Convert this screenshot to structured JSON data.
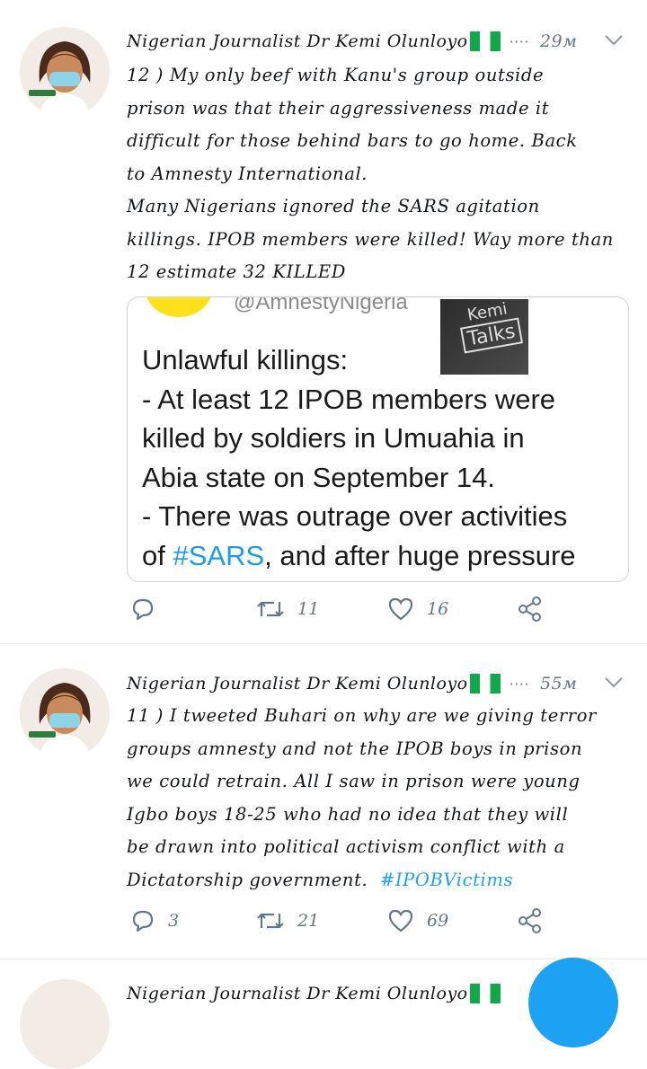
{
  "tweets": [
    {
      "author": "Nigerian Journalist Dr Kemi Olunloyo",
      "time": "29м",
      "text_lines": [
        "12 ) My only beef with Kanu's group outside",
        "prison was that their aggressiveness made it",
        "difficult for those behind bars to go home. Back",
        "to Amnesty International.",
        "Many Nigerians ignored the SARS agitation",
        "killings. IPOB members were killed! Way more than",
        "12 estimate 32 KILLED"
      ],
      "card": {
        "handle": "@AmnestyNigeria",
        "badge_line1": "Kemi",
        "badge_line2": "Talks",
        "lines": [
          "Unlawful killings:",
          "- At least 12 IPOB members were",
          "killed by soldiers in Umuahia in",
          "Abia state on September 14.",
          "- There was outrage over activities"
        ],
        "line6_before": "of ",
        "line6_tag": "#SARS",
        "line6_after": ", and after huge pressure"
      },
      "replies": "",
      "retweets": "11",
      "likes": "16"
    },
    {
      "author": "Nigerian Journalist Dr Kemi Olunloyo",
      "time": "55м",
      "text_lines": [
        "11 ) I tweeted Buhari on why are we giving terror",
        "groups amnesty and not the IPOB boys in prison",
        "we could retrain. All I saw in prison were young",
        "Igbo boys 18-25 who had no idea that they will",
        "be drawn into political activism conflict with a"
      ],
      "last_line": "Dictatorship government.",
      "hashtag": "#IPOBVictims",
      "replies": "3",
      "retweets": "21",
      "likes": "69"
    },
    {
      "author": "Nigerian Journalist Dr Kemi Olunloyo"
    }
  ],
  "icons": {
    "reply": "reply-icon",
    "retweet": "retweet-icon",
    "like": "heart-icon",
    "share": "share-icon",
    "more": "chevron-down-icon"
  },
  "colors": {
    "accent": "#1da1f2",
    "muted": "#657786",
    "flag_green": "#11a84b"
  }
}
